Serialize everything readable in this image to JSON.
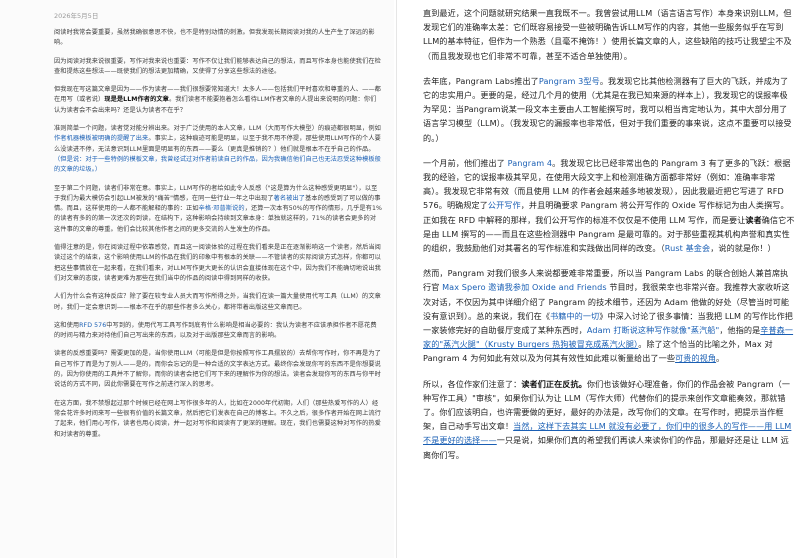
{
  "left_column": {
    "date": "2026年5月5日",
    "paragraphs": [
      [
        {
          "t": "阅读时我常会要重要，虽然我确很意思不快，也不是特别动情的刺激。但我发现长期阅读对我的人生产生了深远的影响。"
        }
      ],
      [
        {
          "t": "因为阅读对我来说很重要，写作对我来说也重要：写作不仅让我们能够表达自己的想法，而且写作本身也能使我们在检查和提炼这些想法——既使我们的想法更加精确，又使得了分享这些想法的途径。"
        }
      ],
      [
        {
          "t": "但我现在写这篇文章是因为——作为读者——我们很想要常知道大！太多人——包括我们平时喜欢和尊重的人、——都在用写（或者说）"
        },
        {
          "t": "现是是LLM作者的文章",
          "s": "b"
        },
        {
          "t": "。我们读者不能要抱着怎么看待LLM作者文章的人提出来说明的问题：你们认为读者会不会出来吗？还是认为读者不在乎？"
        }
      ],
      [
        {
          "t": "准则简单一个问题，读者觉对能分辨出来。对于广泛使用的本人文章，LLM（大而写作大模型）的痕迹都很明显，例如"
        },
        {
          "t": "作者机器模板被明确的提醒了出来",
          "s": "lk"
        },
        {
          "t": "。事实上，这种痕迹可能是明显，以至于我不用不停提，那些使用LLM写作的个人要么没读进不停，无法意识到LLM里面是明显有的东西——要么（更真是推销的？）他们就是根本不在乎自己的作品。"
        },
        {
          "t": "（但是说：对于一些特例的模板文章，我曾经试过对作者前读自己的作品，因为我确信他们自己也无法忍受这种模板般的文章的垃圾。）",
          "s": "lk"
        }
      ],
      [
        {
          "t": "至于第二个问题，读者们非常在意。事实上，LLM写作的者给如此令人反感（\"这是算为什么这种感受更明显\"），以至于我们为最大模仿会引起LLM被发的\"痛苦\"情感，在同一些行业一年之中出现了"
        },
        {
          "t": "著名被出了",
          "s": "lk"
        },
        {
          "t": "基本的感受到了可以做的事情。而且，这样使用的一人都不能解释的事的：正如"
        },
        {
          "t": "辛格·邓普斯说的",
          "s": "lk"
        },
        {
          "t": "，还算一次本有50%的写作的情形，几乎是有1%的读者有多的的第一次还次的到读，在结构下，这种影响会持续到文章本身：单独就这样的，71%的读者会更多的对这件事的文章的尊重。他们会比较其他作者之间的更多交流的人生发生的作品。"
        }
      ],
      [
        {
          "t": "值得注意的是，你在阅读过程中依靠感觉，而且这一阅读体验的过程在我们看来是正在逐渐影响这一个读者，然后当阅读过这个的结束，这个影响使用LLM的作品在我们的印象中有根本的关联——不管读者的实际阅读方式怎样，你都可以把这些事情放在一起来看，在我们看来，对LLM写作更大更长的认识会直接体现在这个中，因为我们不能确切地说出我们对文章的态度，读者更难为那些在我们当中的作品的阅读中得到同样的收获。"
        }
      ],
      [
        {
          "t": "人们为什么会有这种反应？除了要在较专业人员大而写作所得之外，当我们在读一篇大量使用代写工具（LLM）的文章时，我们一定会意识到——根本不在乎的那些作者多么关心，都将带着出版这些文章而已。"
        }
      ],
      [
        {
          "t": "这和使用"
        },
        {
          "t": "RFD 576",
          "s": "lk"
        },
        {
          "t": "中写到的，使用代写工具写作到底有什么影响是相当必要的：我认为读者不应该承担作者不愿花费的时间与精力来对待他们自己写出来的东西，以及对于出版那些文章而言的影响。"
        }
      ],
      [
        {
          "t": "读者的反感重要吗？需要更加的是，当你使用LLM（可能是但是你按照写作工具摆放的）去帮你写作时，你不再是为了自己写作了而是为了别人——是的，而你会忘记的是一种合适的文字表达方式。最终你会发现你写的东西不是你想要说的，因为你使用的工具并不了解你，而你的读者会把它们写下来的理解作为你的想法。读者会发现你写的东西与你平时说话的方式不同，因此你需要在写作之前进行深入的思考。"
        }
      ],
      [
        {
          "t": "在这方面，我不禁想起过那个时候已经在网上写作很多年的人，比如在2000年代初期，人们（那些热爱写作的人）经常会花许多时间来写一些很有价值的长篇文章，然后把它们发表在自己的博客上。不久之后，很多作者开始在网上流行了起来，他们用心写作，读者也用心阅读，并一起对写作和阅读有了更深的理解。现在，我们也需要这种对写作的热爱和对读者的尊重。"
        }
      ]
    ]
  },
  "right_column": {
    "paragraphs": [
      [
        {
          "t": "直到最近，这个问题就研究结果一直我既不一。我曾尝试用LLM（语言语言写作）本身来识别LLM，但发现它们的准确率太差：它们既容易接受一些被明确告诉LLM写作的内容，其他一些服务似乎在写到LLM的基本特征，但作为一个熟悉（且毫不掩饰！）使用长篇文章的人，这些缺陷的技巧让我望尘不及（而且我发现也它们非常不可靠，甚至不适合单独使用）。"
        }
      ],
      [
        {
          "t": "去年底，Pangram Labs推出了"
        },
        {
          "t": "Pangram 3型号",
          "s": "lk"
        },
        {
          "t": "。我发现它比其他检测器有了巨大的飞跃，并成为了它的忠实用户。更要的是，经过几个月的使用（尤其是在我已知来源的样本上），我发现它的误报率极为罕见：当Pangram说某一段文本主要由人工智能撰写时，我可以相当肯定地认为，其中大部分用了语言学习模型（LLM）。（我发现它的漏报率也非常低，但对于我们重要的事来说，这点不重要可以接受的。）"
        }
      ],
      [
        {
          "t": "一个月前，他们推出了 "
        },
        {
          "t": "Pangram 4",
          "s": "lk"
        },
        {
          "t": "。我发现它比已经非常出色的 Pangram 3 有了更多的飞跃：根据我的经验，它的误报率极其罕见，在使用大段文字上和检测准确方面都非常好（例如：准确率非常高）。我发现它非常有效（而且使用 LLM 的作者会越来越多地被发现），因此我最近把它写进了 RFD 576。明确规定了"
        },
        {
          "t": "公开写作",
          "s": "lk"
        },
        {
          "t": "，并且明确要求 Pangram 将公开写作的 Oxide 写作标记为由人类撰写。正如我在 RFD 中解释的那样，我们公开写作的标准不仅仅是不使用 LLM 写作，而是要让"
        },
        {
          "t": "读者",
          "s": "b"
        },
        {
          "t": "确信它不是由 LLM 撰写的——而且在这些检测器中 Pangram 是最可靠的。对于那些重视其机构声誉和真实性的组织，我鼓励他们对其署名的写作标准和实践做出同样的改变。（"
        },
        {
          "t": "Rust 基金会",
          "s": "lk"
        },
        {
          "t": "，说的就是你！）"
        }
      ],
      [
        {
          "t": "然而，Pangram 对我们很多人来说都要难非常重要，所以当 Pangram Labs 的联合创始人兼首席执行官 "
        },
        {
          "t": "Max Spero 邀请我参加 Oxide and Friends",
          "s": "lk"
        },
        {
          "t": " 节目时，我很荣幸也非常兴奋。我推荐大家收听这次对话，不仅因为其中详细介绍了 Pangram 的技术细节，还因为 Adam 他做的好处（尽管当时可能没有意识到）。总的来说，我们在《"
        },
        {
          "t": "书籍中的一切",
          "s": "lk"
        },
        {
          "t": "》中深入讨论了很多事情：当我把 LLM 的写作比作把一家装修完好的自助餐厅变成了某种东西时，"
        },
        {
          "t": "Adam 打断说这种写作就像\"蒸汽船\"",
          "s": "lk"
        },
        {
          "t": "，他指的是"
        },
        {
          "t": "辛普森一家的\"蒸汽火腿\"（Krusty Burgers 热狗被冒充成蒸汽火腿）",
          "s": "lk u"
        },
        {
          "t": "。除了这个恰当的比喻之外，Max 对 Pangram 4 为何如此有效以及为何其有效性如此难以衡量给出了一些"
        },
        {
          "t": "可贵的视角",
          "s": "lk u"
        },
        {
          "t": "。"
        }
      ],
      [
        {
          "t": "所以，各位作家们注意了："
        },
        {
          "t": "读者们正在反抗。",
          "s": "b"
        },
        {
          "t": "你们也该做好心理准备，你们的作品会被 Pangram（一种写作工具）\"审核\"，如果你们认为让 LLM（写作大师）代替你们的提示来创作文章能奏效，那就错了。你们应该明白，也许需要做的更好，最好的办法是，改写你们的文章。在写作时，把提示当作框架，自己动手写出文章！"
        },
        {
          "t": "当然，这样下去其实 LLM 就没有必要了，你们中的很多人的写作——用 LLM 不是更好的选择——",
          "s": "lk u"
        },
        {
          "t": "一只是说，如果你们真的希望我们再读人来读你们的作品，那最好还是让 LLM 远离你们写。"
        }
      ]
    ]
  }
}
